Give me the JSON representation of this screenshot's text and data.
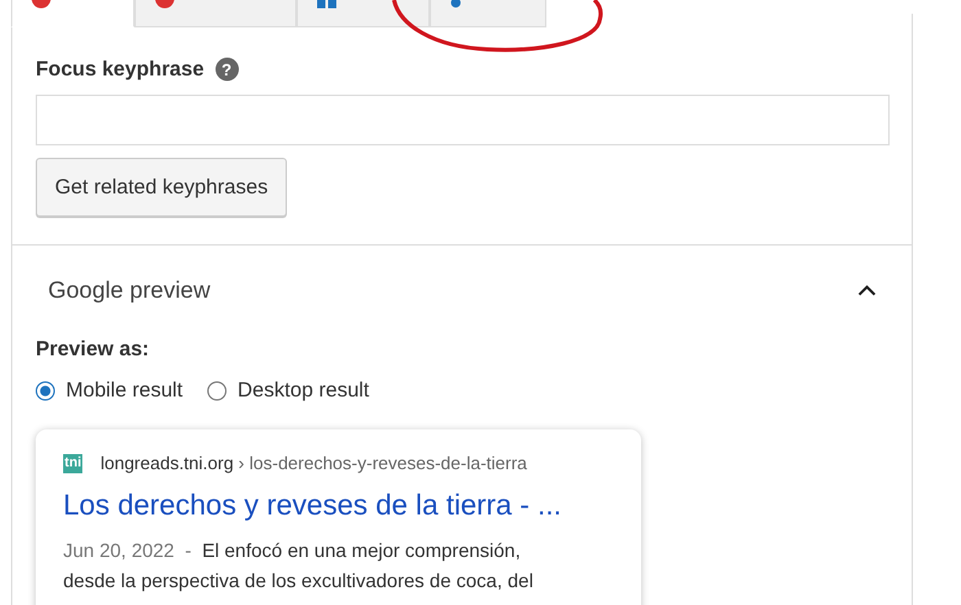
{
  "tabs": [
    {
      "kind": "score",
      "selected": true,
      "color": "#dc3232"
    },
    {
      "kind": "score",
      "selected": false,
      "color": "#dc3232"
    },
    {
      "kind": "schema",
      "selected": false,
      "color": "#1e73be"
    },
    {
      "kind": "social",
      "selected": false,
      "color": "#1e73be"
    }
  ],
  "focus_keyphrase": {
    "label": "Focus keyphrase",
    "help": "?"
  },
  "related_button": "Get related keyphrases",
  "google_preview": {
    "title": "Google preview",
    "expanded": true,
    "preview_as": "Preview as:",
    "options": [
      {
        "label": "Mobile result",
        "selected": true
      },
      {
        "label": "Desktop result",
        "selected": false
      }
    ],
    "result": {
      "favicon": "tni",
      "domain": "longreads.tni.org",
      "path": "› los-derechos-y-reveses-de-la-tierra",
      "title": "Los derechos y reveses de la tierra - ...",
      "date": "Jun 20, 2022",
      "separator": "-",
      "snippet": "El enfocó en una mejor comprensión, desde la perspectiva de los excultivadores de coca, del"
    }
  }
}
